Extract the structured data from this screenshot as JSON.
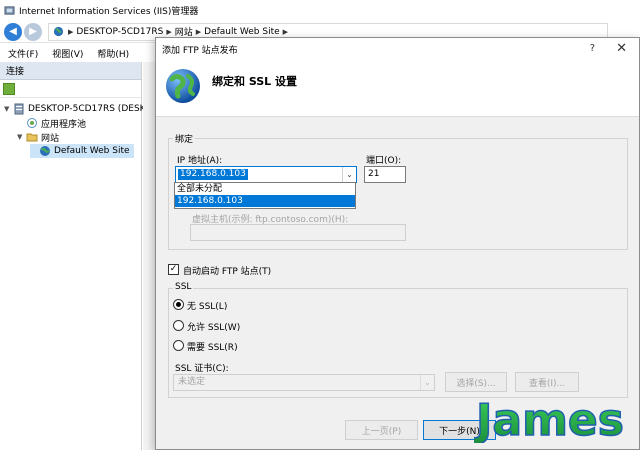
{
  "app": {
    "title": "Internet Information Services (IIS)管理器"
  },
  "address": {
    "segments": [
      "DESKTOP-5CD17RS",
      "网站",
      "Default Web Site"
    ]
  },
  "menu": {
    "items": [
      "文件(F)",
      "视图(V)",
      "帮助(H)"
    ]
  },
  "left_pane": {
    "header": "连接",
    "tree": {
      "server": "DESKTOP-5CD17RS (DESKT",
      "app_pools": "应用程序池",
      "sites": "网站",
      "default_site": "Default Web Site"
    }
  },
  "dialog": {
    "title": "添加 FTP 站点发布",
    "help": "?",
    "close": "✕",
    "heading": "绑定和 SSL 设置",
    "binding": {
      "group_label": "绑定",
      "ip_label": "IP 地址(A):",
      "ip_value": "192.168.0.103",
      "ip_options": [
        "全部未分配",
        "192.168.0.103"
      ],
      "ip_highlighted": "192.168.0.103",
      "port_label": "端口(O):",
      "port_value": "21",
      "virtual_host_label": "虚拟主机(示例: ftp.contoso.com)(H):",
      "virtual_host_value": ""
    },
    "auto_start": {
      "label": "自动启动 FTP 站点(T)",
      "checked": true,
      "mark": "✓"
    },
    "ssl": {
      "group_label": "SSL",
      "options": [
        "无 SSL(L)",
        "允许 SSL(W)",
        "需要 SSL(R)"
      ],
      "selected_index": 0,
      "cert_label": "SSL 证书(C):",
      "cert_value": "未选定",
      "select_button": "选择(S)...",
      "view_button": "查看(I)..."
    },
    "buttons": {
      "previous": "上一页(P)",
      "next": "下一步(N)"
    }
  },
  "watermark": {
    "text": "James"
  },
  "colors": {
    "accent": "#0078d7",
    "dialog_bg": "#f0f0f0",
    "watermark_green": "#2bb24c",
    "watermark_blue": "#1f5fae"
  }
}
